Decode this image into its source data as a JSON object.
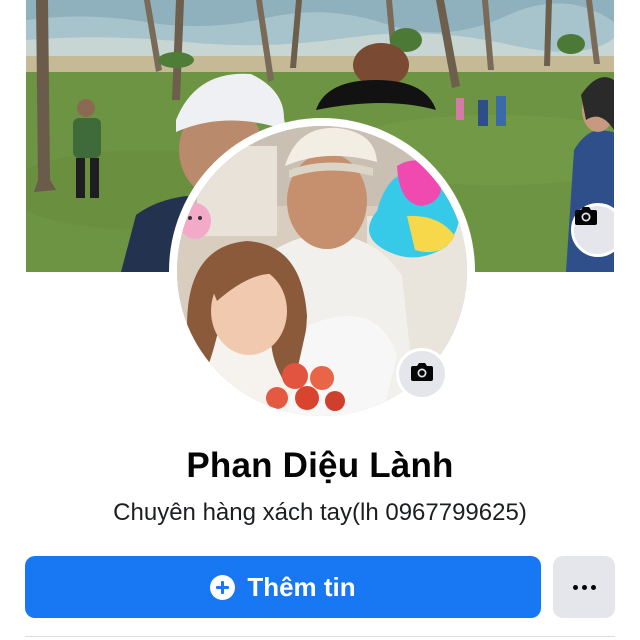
{
  "profile": {
    "name": "Phan Diệu Lành",
    "bio": "Chuyên hàng xách tay(lh 0967799625)"
  },
  "actions": {
    "primary_label": "Thêm tin",
    "primary_icon": "plus-circle-icon",
    "more_icon": "more-horizontal-icon"
  },
  "cover_photo": {
    "camera_icon": "camera-icon"
  },
  "avatar": {
    "camera_icon": "camera-icon"
  },
  "colors": {
    "primary": "#1877f2",
    "secondary_button": "#e4e6eb",
    "text": "#050505"
  }
}
